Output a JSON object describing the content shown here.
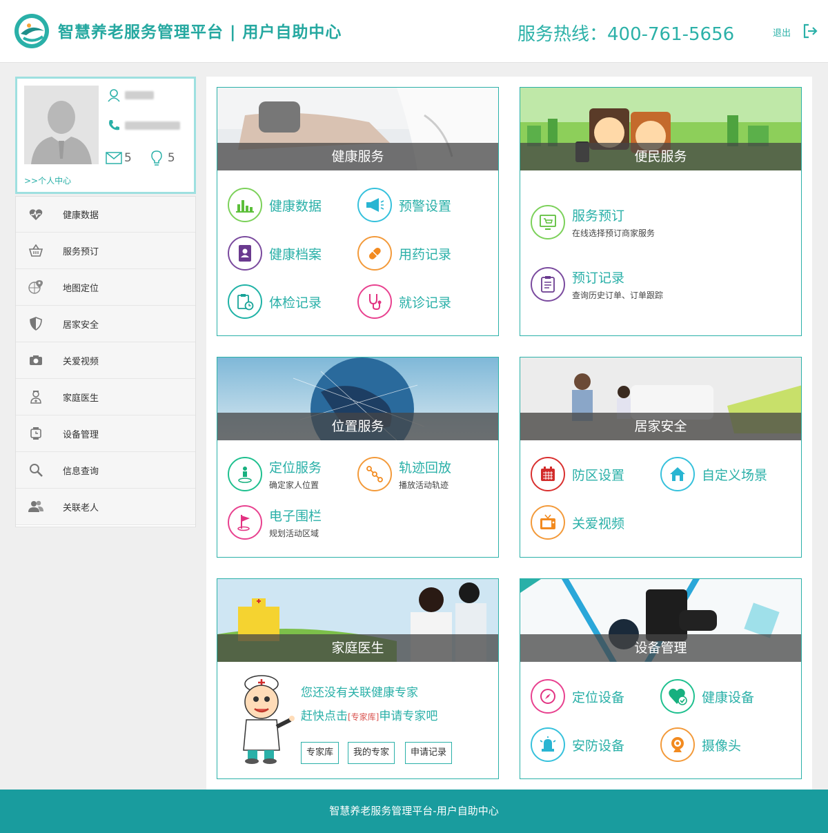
{
  "header": {
    "brand": "智慧养老服务管理平台 | 用户自助中心",
    "hotline": "服务热线：400-761-5656",
    "logout": "退出"
  },
  "profile": {
    "messages": "5",
    "alerts": "5",
    "personal_center": ">>个人中心"
  },
  "menu": [
    {
      "label": "健康数据",
      "icon": "heart-pulse-icon"
    },
    {
      "label": "服务预订",
      "icon": "basket-icon"
    },
    {
      "label": "地图定位",
      "icon": "globe-pin-icon"
    },
    {
      "label": "居家安全",
      "icon": "shield-icon"
    },
    {
      "label": "关爱视频",
      "icon": "camera-icon"
    },
    {
      "label": "家庭医生",
      "icon": "doctor-icon"
    },
    {
      "label": "设备管理",
      "icon": "watch-icon"
    },
    {
      "label": "信息查询",
      "icon": "magnifier-icon"
    },
    {
      "label": "关联老人",
      "icon": "users-icon"
    }
  ],
  "cards": {
    "health": {
      "title": "健康服务",
      "items": [
        "健康数据",
        "预警设置",
        "健康档案",
        "用药记录",
        "体检记录",
        "就诊记录"
      ]
    },
    "convenience": {
      "title": "便民服务",
      "items": [
        {
          "label": "服务预订",
          "sub": "在线选择预订商家服务"
        },
        {
          "label": "预订记录",
          "sub": "查询历史订单、订单跟踪"
        }
      ]
    },
    "location": {
      "title": "位置服务",
      "items": [
        {
          "label": "定位服务",
          "sub": "确定家人位置"
        },
        {
          "label": "轨迹回放",
          "sub": "播放活动轨迹"
        },
        {
          "label": "电子围栏",
          "sub": "规划活动区域"
        }
      ]
    },
    "home_safety": {
      "title": "居家安全",
      "items": [
        "防区设置",
        "自定义场景",
        "关爱视频"
      ]
    },
    "family_doctor": {
      "title": "家庭医生",
      "line1": "您还没有关联健康专家",
      "line2_prefix": "赶快点击",
      "line2_link": "[专家库]",
      "line2_suffix": "申请专家吧",
      "buttons": [
        "专家库",
        "我的专家",
        "申请记录"
      ]
    },
    "devices": {
      "title": "设备管理",
      "items": [
        "定位设备",
        "健康设备",
        "安防设备",
        "摄像头"
      ]
    }
  },
  "footer": "智慧养老服务管理平台-用户自助中心",
  "colors": {
    "accent": "#2ab0a8",
    "footer": "#199c9e"
  }
}
